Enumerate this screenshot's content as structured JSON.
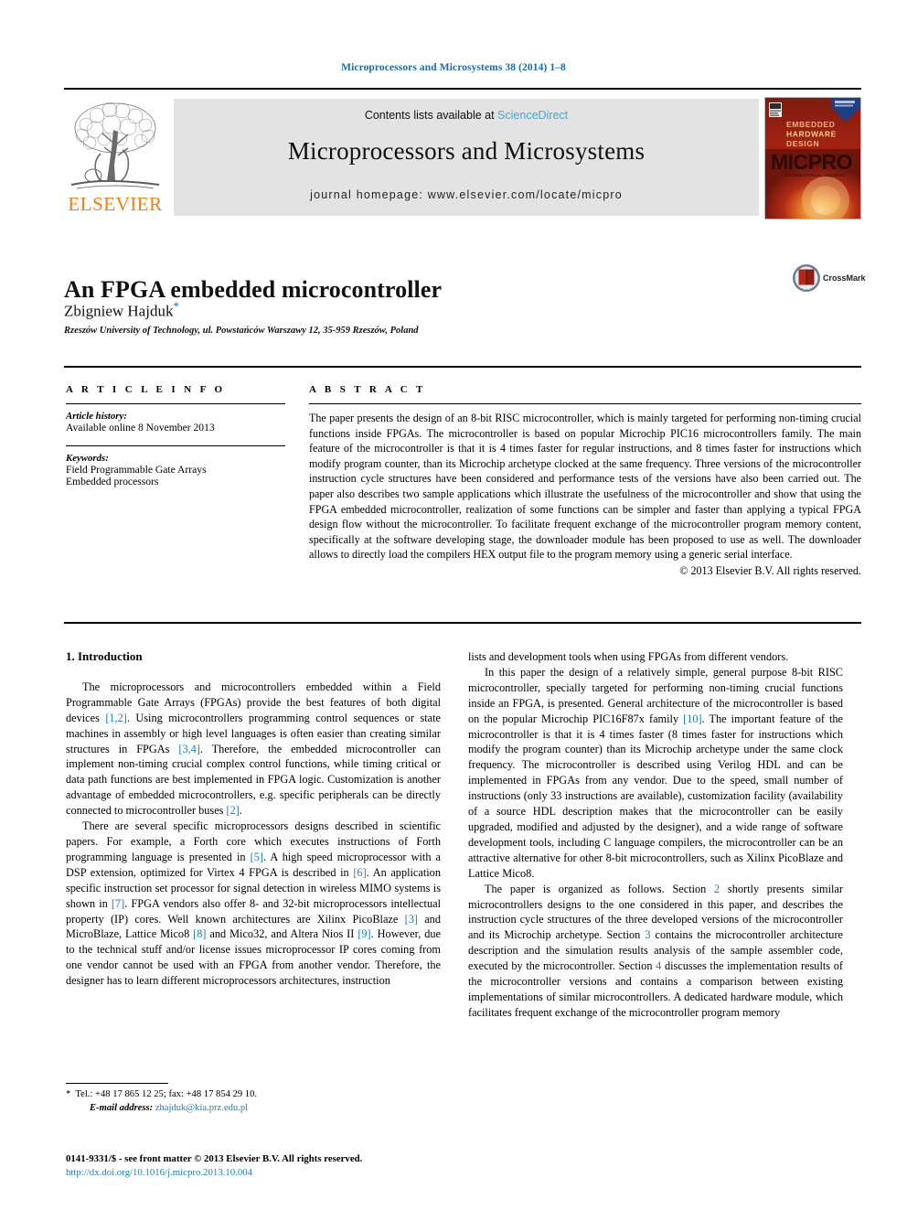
{
  "running_head": "Microprocessors and Microsystems 38 (2014) 1–8",
  "masthead": {
    "publisher_name": "ELSEVIER",
    "contents_prefix": "Contents lists available at ",
    "sciencedirect": "ScienceDirect",
    "journal_title": "Microprocessors and Microsystems",
    "homepage": "journal homepage: www.elsevier.com/locate/micpro",
    "cover": {
      "line1": "EMBEDDED",
      "line2": "HARDWARE",
      "line3": "DESIGN",
      "brand": "MICPRO",
      "subtitle": "INTERNATIONAL JOURNAL"
    }
  },
  "article": {
    "title": "An FPGA embedded microcontroller",
    "author": "Zbigniew Hajduk",
    "author_marker": "*",
    "affiliation": "Rzeszów University of Technology, ul. Powstańców Warszawy 12, 35-959 Rzeszów, Poland",
    "crossmark_label": "CrossMark"
  },
  "info": {
    "heading": "A R T I C L E   I N F O",
    "history_label": "Article history:",
    "history_value": "Available online 8 November 2013",
    "keywords_label": "Keywords:",
    "keywords": [
      "Field Programmable Gate Arrays",
      "Embedded processors"
    ]
  },
  "abstract": {
    "heading": "A B S T R A C T",
    "body": "The paper presents the design of an 8-bit RISC microcontroller, which is mainly targeted for performing non-timing crucial functions inside FPGAs. The microcontroller is based on popular Microchip PIC16 microcontrollers family. The main feature of the microcontroller is that it is 4 times faster for regular instructions, and 8 times faster for instructions which modify program counter, than its Microchip archetype clocked at the same frequency. Three versions of the microcontroller instruction cycle structures have been considered and performance tests of the versions have also been carried out. The paper also describes two sample applications which illustrate the usefulness of the microcontroller and show that using the FPGA embedded microcontroller, realization of some functions can be simpler and faster than applying a typical FPGA design flow without the microcontroller. To facilitate frequent exchange of the microcontroller program memory content, specifically at the software developing stage, the downloader module has been proposed to use as well. The downloader allows to directly load the compilers HEX output file to the program memory using a generic serial interface.",
    "copyright": "© 2013 Elsevier B.V. All rights reserved."
  },
  "section": {
    "heading": "1. Introduction"
  },
  "body": {
    "left": {
      "p1_a": "The microprocessors and microcontrollers embedded within a Field Programmable Gate Arrays (FPGAs) provide the best features of both digital devices ",
      "p1_r1": "[1,2]",
      "p1_b": ". Using microcontrollers programming control sequences or state machines in assembly or high level languages is often easier than creating similar structures in FPGAs ",
      "p1_r2": "[3,4]",
      "p1_c": ". Therefore, the embedded microcontroller can implement non-timing crucial complex control functions, while timing critical or data path functions are best implemented in FPGA logic. Customization is another advantage of embedded microcontrollers, e.g. specific peripherals can be directly connected to microcontroller buses ",
      "p1_r3": "[2]",
      "p1_d": ".",
      "p2_a": "There are several specific microprocessors designs described in scientific papers. For example, a Forth core which executes instructions of Forth programming language is presented in ",
      "p2_r1": "[5]",
      "p2_b": ". A high speed microprocessor with a DSP extension, optimized for Virtex 4 FPGA is described in ",
      "p2_r2": "[6]",
      "p2_c": ". An application specific instruction set processor for signal detection in wireless MIMO systems is shown in ",
      "p2_r3": "[7]",
      "p2_d": ". FPGA vendors also offer 8- and 32-bit microprocessors intellectual property (IP) cores. Well known architectures are Xilinx PicoBlaze ",
      "p2_r4": "[3]",
      "p2_e": " and MicroBlaze, Lattice Mico8 ",
      "p2_r5": "[8]",
      "p2_f": " and Mico32, and Altera Nios II ",
      "p2_r6": "[9]",
      "p2_g": ". However, due to the technical stuff and/or license issues microprocessor IP cores coming from one vendor cannot be used with an FPGA from another vendor. Therefore, the designer has to learn different microprocessors architectures, instruction"
    },
    "right": {
      "p0": "lists and development tools when using FPGAs from different vendors.",
      "p1_a": "In this paper the design of a relatively simple, general purpose 8-bit RISC microcontroller, specially targeted for performing non-timing crucial functions inside an FPGA, is presented. General architecture of the microcontroller is based on the popular Microchip PIC16F87x family ",
      "p1_r1": "[10]",
      "p1_b": ". The important feature of the microcontroller is that it is 4 times faster (8 times faster for instructions which modify the program counter) than its Microchip archetype under the same clock frequency. The microcontroller is described using Verilog HDL and can be implemented in FPGAs from any vendor. Due to the speed, small number of instructions (only 33 instructions are available), customization facility (availability of a source HDL description makes that the microcontroller can be easily upgraded, modified and adjusted by the designer), and a wide range of software development tools, including C language compilers, the microcontroller can be an attractive alternative for other 8-bit microcontrollers, such as Xilinx PicoBlaze and Lattice Mico8.",
      "p2_a": "The paper is organized as follows. Section ",
      "p2_r1": "2",
      "p2_b": " shortly presents similar microcontrollers designs to the one considered in this paper, and describes the instruction cycle structures of the three developed versions of the microcontroller and its Microchip archetype. Section ",
      "p2_r2": "3",
      "p2_c": " contains the microcontroller architecture description and the simulation results analysis of the sample assembler code, executed by the microcontroller. Section ",
      "p2_r3": "4",
      "p2_d": " discusses the implementation results of the microcontroller versions and contains a comparison between existing implementations of similar microcontrollers. A dedicated hardware module, which facilitates frequent exchange of the microcontroller program memory"
    }
  },
  "footnote": {
    "marker": "*",
    "tel": "Tel.: +48 17 865 12 25; fax: +48 17 854 29 10.",
    "email_label": "E-mail address:",
    "email": "zhajduk@kia.prz.edu.pl"
  },
  "imprint": {
    "line1": "0141-9331/$ - see front matter © 2013 Elsevier B.V. All rights reserved.",
    "doi": "http://dx.doi.org/10.1016/j.micpro.2013.10.004"
  },
  "colors": {
    "link_blue": "#1b7fb8",
    "header_blue": "#1b6ca8",
    "sciencedirect_blue": "#3fa9d6",
    "elsevier_orange": "#f07e13",
    "banner_gray": "#e3e3e3"
  }
}
